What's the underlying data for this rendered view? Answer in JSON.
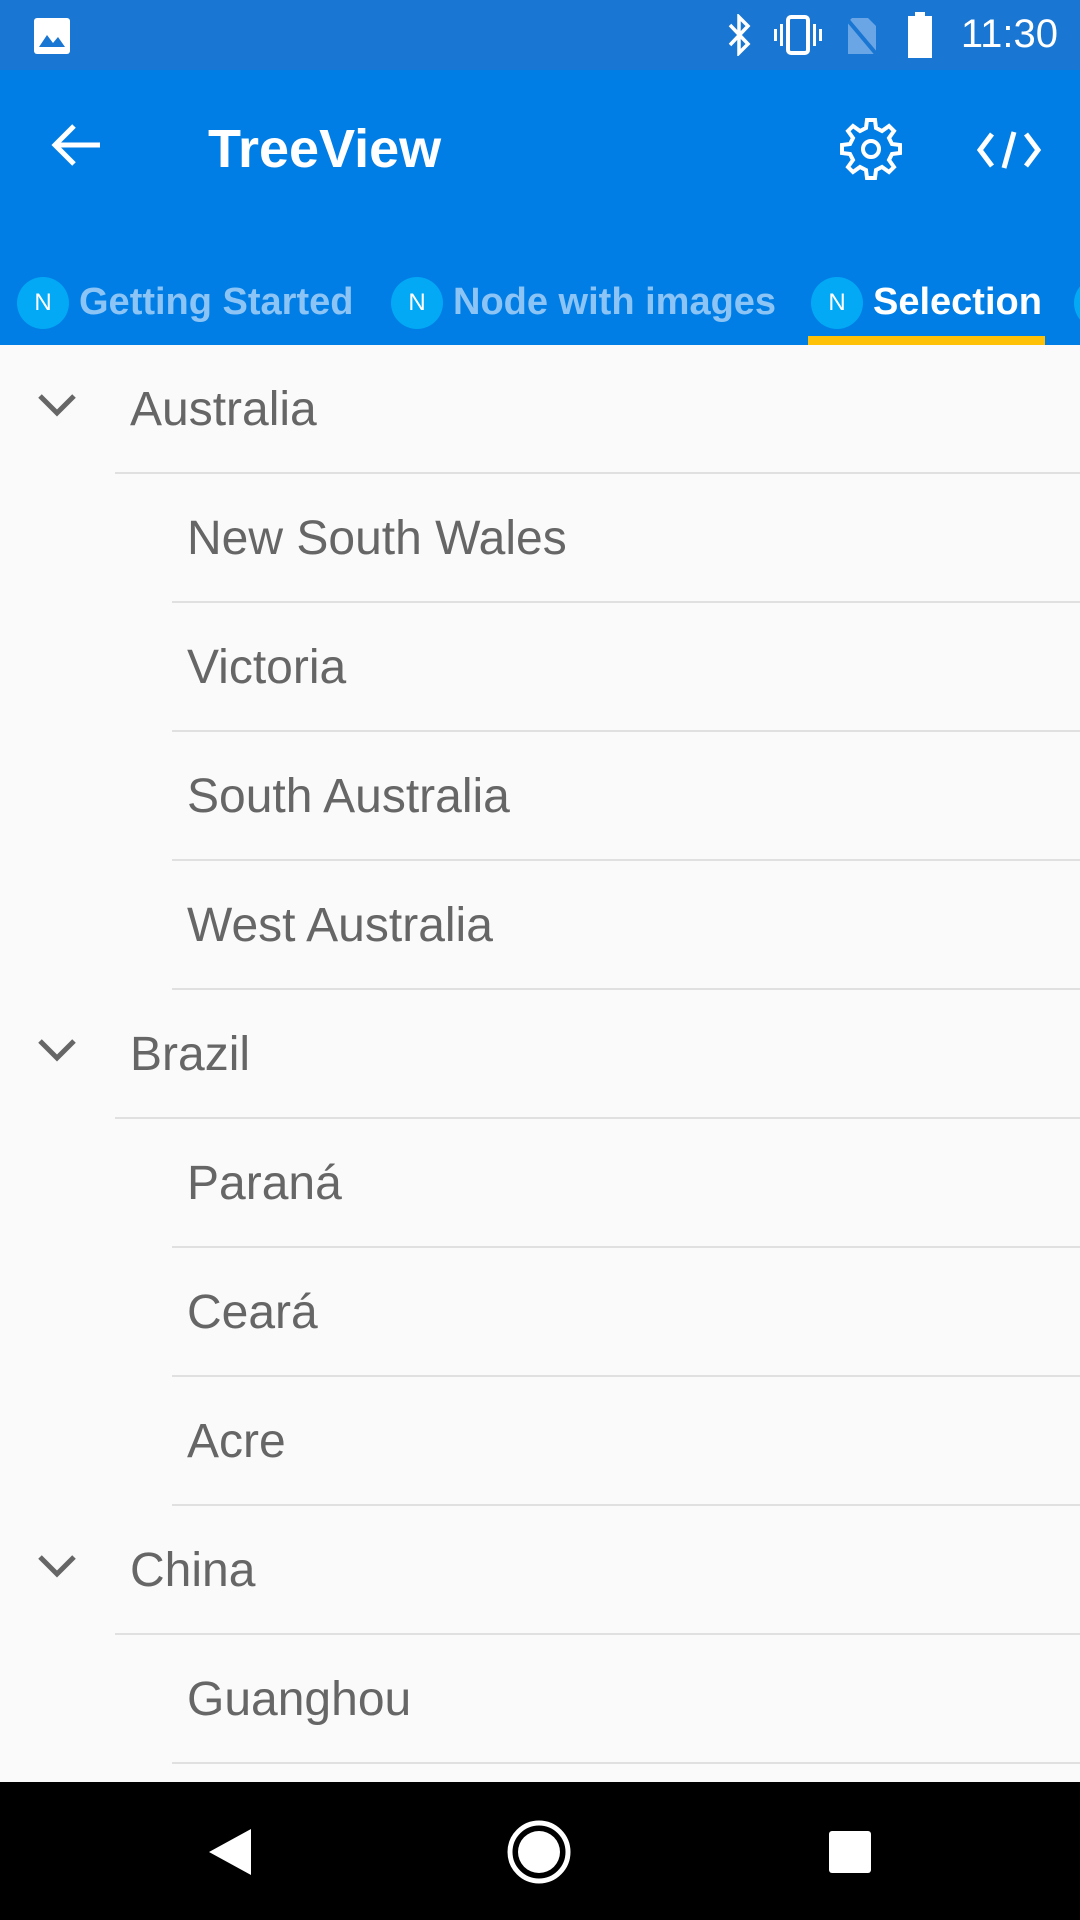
{
  "status_bar": {
    "time": "11:30",
    "icons": [
      "image-icon",
      "bluetooth-icon",
      "vibrate-icon",
      "no-sim-icon",
      "battery-icon"
    ]
  },
  "app_bar": {
    "title": "TreeView",
    "back_icon": "arrow-left-icon",
    "settings_icon": "gear-icon",
    "code_icon": "code-icon"
  },
  "tabs": [
    {
      "badge": "N",
      "label": "Getting Started",
      "active": false
    },
    {
      "badge": "N",
      "label": "Node with images",
      "active": false
    },
    {
      "badge": "N",
      "label": "Selection",
      "active": true
    }
  ],
  "colors": {
    "status_bar": "#1976d2",
    "app_bar": "#007ee5",
    "indicator": "#ffc107",
    "badge": "#03a9f4"
  },
  "tree": [
    {
      "label": "Australia",
      "level": 0,
      "expanded": true
    },
    {
      "label": "New South Wales",
      "level": 1
    },
    {
      "label": "Victoria",
      "level": 1
    },
    {
      "label": "South Australia",
      "level": 1
    },
    {
      "label": "West Australia",
      "level": 1
    },
    {
      "label": "Brazil",
      "level": 0,
      "expanded": true
    },
    {
      "label": "Paraná",
      "level": 1
    },
    {
      "label": "Ceará",
      "level": 1
    },
    {
      "label": "Acre",
      "level": 1
    },
    {
      "label": "China",
      "level": 0,
      "expanded": true
    },
    {
      "label": "Guanghou",
      "level": 1
    }
  ]
}
